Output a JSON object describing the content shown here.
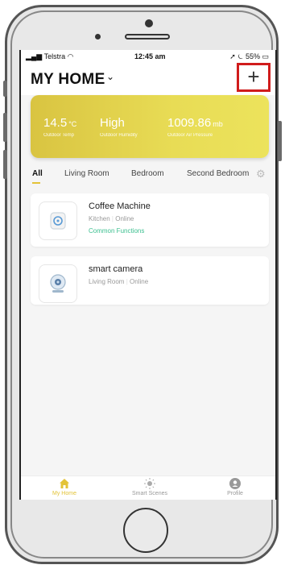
{
  "status": {
    "carrier": "Telstra",
    "time": "12:45 am",
    "battery": "55%"
  },
  "header": {
    "title": "MY HOME",
    "add_label": "+"
  },
  "weather": {
    "temp_value": "14.5",
    "temp_unit": "°C",
    "temp_label": "Outdoor Temp",
    "humidity_value": "High",
    "humidity_label": "Outdoor Humidity",
    "pressure_value": "1009.86",
    "pressure_unit": "mb",
    "pressure_label": "Outdoor Air Pressure"
  },
  "tabs": [
    "All",
    "Living Room",
    "Bedroom",
    "Second Bedroom"
  ],
  "devices": [
    {
      "name": "Coffee Machine",
      "room": "Kitchen",
      "status": "Online",
      "functions": "Common Functions"
    },
    {
      "name": "smart camera",
      "room": "Living Room",
      "status": "Online"
    }
  ],
  "tabbar": {
    "home": "My Home",
    "scenes": "Smart Scenes",
    "profile": "Profile"
  },
  "colors": {
    "accent": "#e3c338",
    "online_green": "#3bbf8f",
    "highlight_red": "#d01c1c"
  }
}
